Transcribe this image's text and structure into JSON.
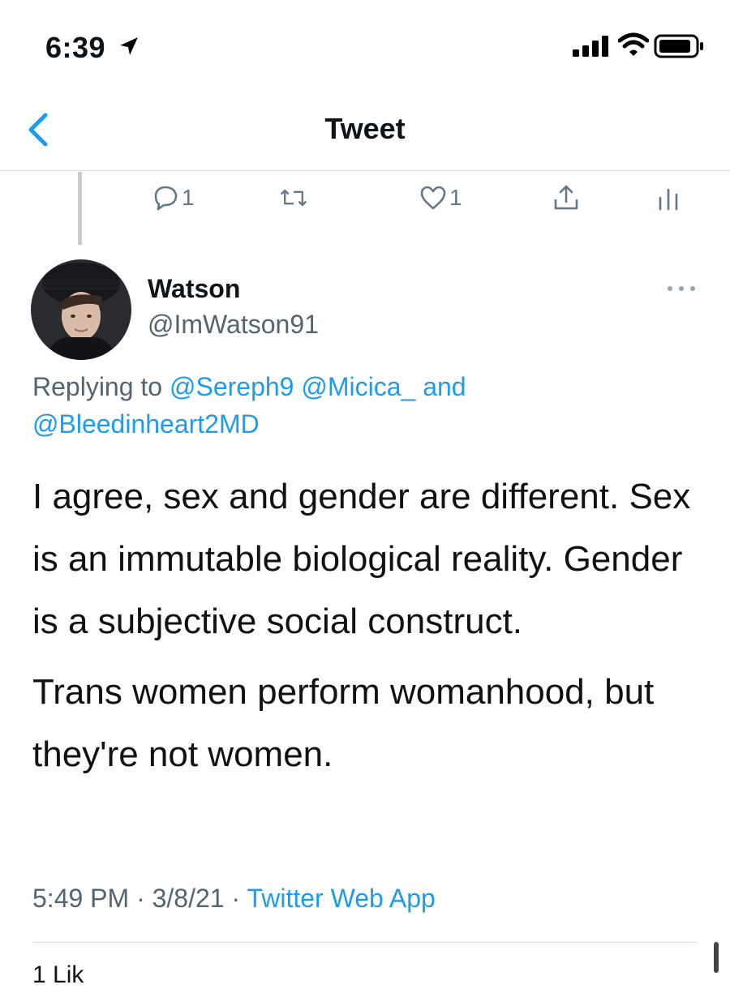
{
  "status_bar": {
    "time": "6:39"
  },
  "header": {
    "title": "Tweet"
  },
  "previous_tweet_actions": {
    "reply_count": "1",
    "like_count": "1"
  },
  "tweet": {
    "author_name": "Watson",
    "author_handle": "@ImWatson91",
    "replying_to_prefix": "Replying to",
    "reply_mentions": [
      "@Sereph9",
      "@Micica_"
    ],
    "reply_and": "and",
    "reply_last_mention": "@Bleedinheart2MD",
    "paragraphs": [
      "I agree, sex and gender are different. Sex is an immutable biological reality. Gender is a subjective social construct.",
      "Trans women perform womanhood, but they're not women."
    ],
    "time": "5:49 PM",
    "date": "3/8/21",
    "separator": "·",
    "source": "Twitter Web App",
    "likes_peek": "1 Lik"
  },
  "colors": {
    "accent": "#1d9bf0",
    "secondary_text": "#536471",
    "icon_gray": "#657786"
  }
}
